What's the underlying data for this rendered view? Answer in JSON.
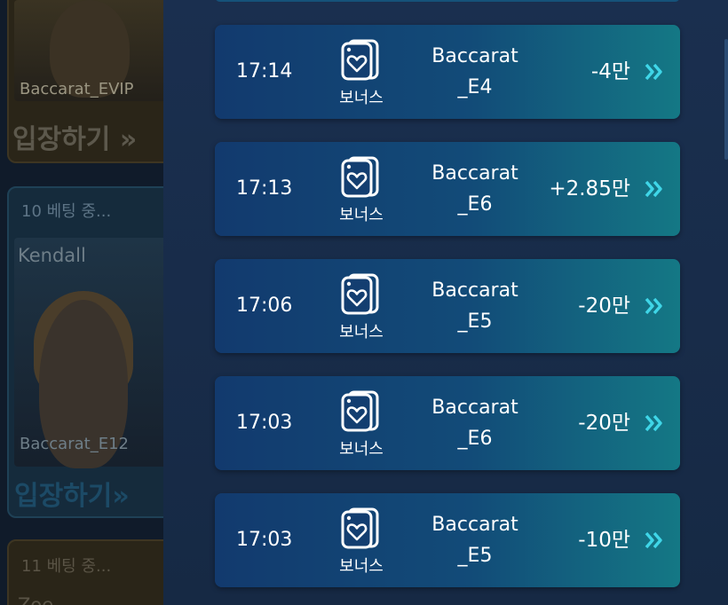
{
  "lobby": {
    "cards": [
      {
        "table_label": "Baccarat_EVIP",
        "enter_label": "입장하기 »"
      },
      {
        "bet_label": "10  베팅 중...",
        "dealer": "Kendall",
        "table_label": "Baccarat_E12",
        "enter_label": "입장하기»"
      },
      {
        "bet_label": "11  베팅 중...",
        "dealer": "Zoe"
      }
    ]
  },
  "history": {
    "rows": [
      {
        "time": "17:14",
        "bonus_label": "보너스",
        "game_line1": "Baccarat",
        "game_line2": "_E4",
        "amount": "-4만"
      },
      {
        "time": "17:13",
        "bonus_label": "보너스",
        "game_line1": "Baccarat",
        "game_line2": "_E6",
        "amount": "+2.85만"
      },
      {
        "time": "17:06",
        "bonus_label": "보너스",
        "game_line1": "Baccarat",
        "game_line2": "_E5",
        "amount": "-20만"
      },
      {
        "time": "17:03",
        "bonus_label": "보너스",
        "game_line1": "Baccarat",
        "game_line2": "_E6",
        "amount": "-20만"
      },
      {
        "time": "17:03",
        "bonus_label": "보너스",
        "game_line1": "Baccarat",
        "game_line2": "_E5",
        "amount": "-10만"
      }
    ]
  },
  "icons": {
    "row_icon": "heart-card-icon",
    "row_action": "double-chevron-right-icon"
  },
  "colors": {
    "chevron": "#3fd6e8",
    "row_gradient_start": "#123a6e",
    "row_gradient_end": "#147885"
  }
}
